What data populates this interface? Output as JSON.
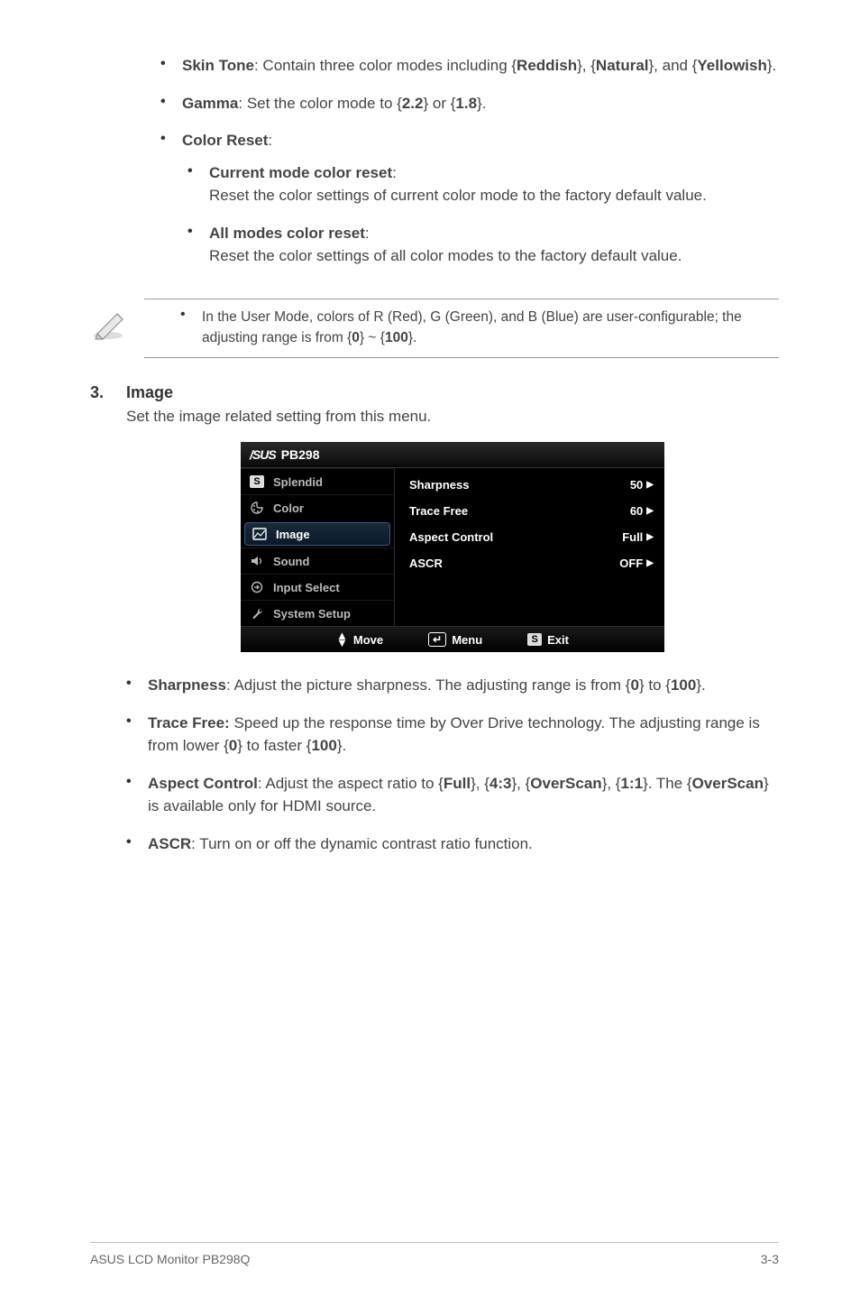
{
  "top_bullets": {
    "skin_tone_label": "Skin Tone",
    "skin_tone_text": ": Contain three color modes including {",
    "skin_tone_opt1": "Reddish",
    "skin_tone_mid1": "}, {",
    "skin_tone_opt2": "Natural",
    "skin_tone_mid2": "}, and {",
    "skin_tone_opt3": "Yellowish",
    "skin_tone_end": "}.",
    "gamma_label": "Gamma",
    "gamma_text": ": Set the color mode to {",
    "gamma_v1": "2.2",
    "gamma_mid": "} or {",
    "gamma_v2": "1.8",
    "gamma_end": "}.",
    "color_reset_label": "Color Reset",
    "color_reset_colon": ":",
    "current_mode_label": "Current mode color reset",
    "current_mode_text": "Reset the color settings of current color mode to the factory default value.",
    "all_modes_label": "All modes color reset",
    "all_modes_text": "Reset the color settings of all color modes to the factory default value."
  },
  "note": {
    "text_pre": "In the User Mode, colors of R (Red), G (Green), and B (Blue) are user-configurable; the adjusting range is from {",
    "v0": "0",
    "mid": "} ~ {",
    "v100": "100",
    "end": "}."
  },
  "section": {
    "num": "3.",
    "title": "Image",
    "desc": "Set the image related setting from this menu."
  },
  "osd": {
    "brand": "/SUS",
    "model": "PB298",
    "menu": {
      "splendid": "Splendid",
      "color": "Color",
      "image": "Image",
      "sound": "Sound",
      "input": "Input Select",
      "system": "System Setup"
    },
    "right": {
      "sharpness": "Sharpness",
      "sharpness_v": "50",
      "tracefree": "Trace Free",
      "tracefree_v": "60",
      "aspect": "Aspect Control",
      "aspect_v": "Full",
      "ascr": "ASCR",
      "ascr_v": "OFF"
    },
    "footer": {
      "move": "Move",
      "menu": "Menu",
      "exit": "Exit",
      "s": "S"
    }
  },
  "lower_bullets": {
    "sharpness_label": "Sharpness",
    "sharpness_text_pre": ": Adjust the picture sharpness. The adjusting range is from {",
    "sharpness_v0": "0",
    "sharpness_mid": "} to {",
    "sharpness_v100": "100",
    "sharpness_end": "}.",
    "tracefree_label": "Trace Free:",
    "tracefree_text_pre": " Speed up the response time by Over Drive technology. The adjusting range is from lower {",
    "tracefree_v0": "0",
    "tracefree_mid": "} to faster {",
    "tracefree_v100": "100",
    "tracefree_end": "}.",
    "aspect_label": "Aspect Control",
    "aspect_text_pre": ": Adjust the aspect ratio to {",
    "aspect_o1": "Full",
    "aspect_m1": "}, {",
    "aspect_o2": "4:3",
    "aspect_m2": "}, {",
    "aspect_o3": "OverScan",
    "aspect_m3": "}, {",
    "aspect_o4": "1:1",
    "aspect_m4": "}. The {",
    "aspect_o5": "OverScan",
    "aspect_end": "} is available only for HDMI source.",
    "ascr_label": "ASCR",
    "ascr_text": ": Turn on or off the dynamic contrast ratio function."
  },
  "footer": {
    "left": "ASUS LCD Monitor PB298Q",
    "right": "3-3"
  }
}
